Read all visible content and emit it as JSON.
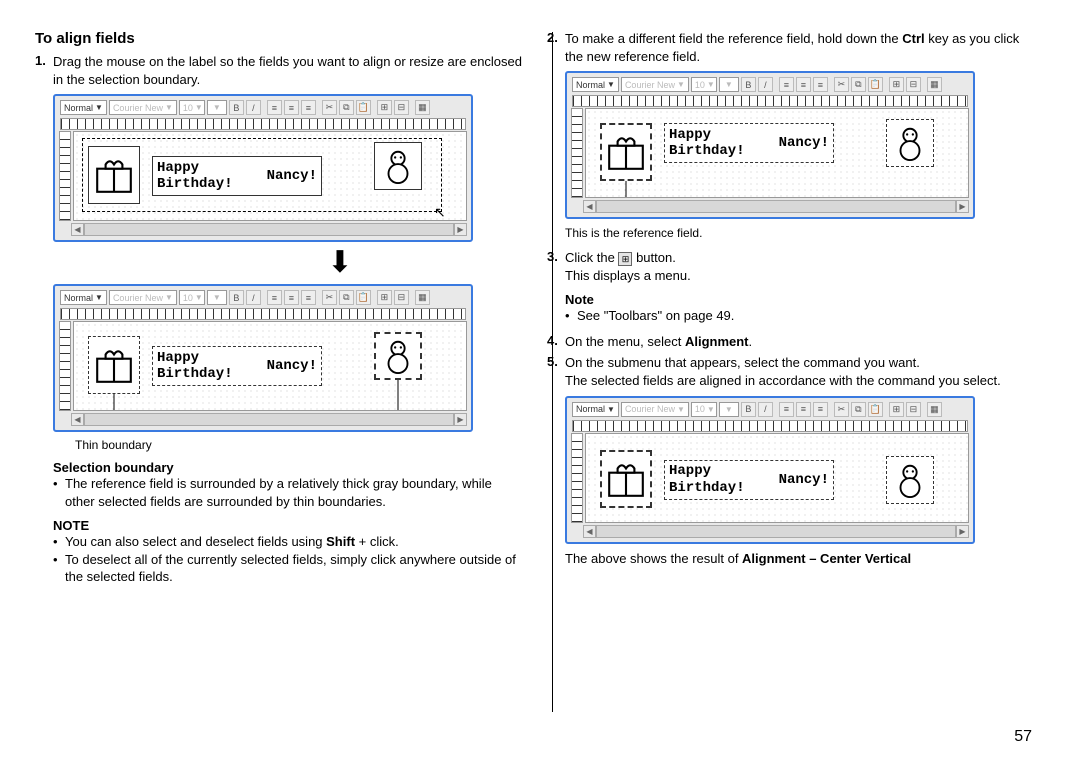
{
  "leftCol": {
    "heading": "To align fields",
    "step1_no": "1.",
    "step1": "Drag the mouse on the label so the fields you want to align or resize are enclosed in the selection boundary.",
    "thinBoundaryCaption": "Thin boundary",
    "selBoundaryHeading": "Selection boundary",
    "selBoundaryBullet": "The reference field is surrounded by a relatively thick gray boundary, while other selected fields are surrounded by thin boundaries.",
    "noteHeading": "NOTE",
    "note1_a": "You can also select and deselect fields using ",
    "note1_b": "Shift",
    "note1_c": " + click.",
    "note2": "To deselect all of the currently selected fields, simply click anywhere outside of the selected fields."
  },
  "rightCol": {
    "step2_no": "2.",
    "step2_a": "To make a different field the reference field, hold down the ",
    "step2_b": "Ctrl",
    "step2_c": " key as you click the new reference field.",
    "refCaption": "This is the reference field.",
    "step3_no": "3.",
    "step3_a": "Click the ",
    "step3_b": " button.",
    "step3_c": "This displays a menu.",
    "noteHeading": "Note",
    "note1": "See \"Toolbars\" on page 49.",
    "step4_no": "4.",
    "step4_a": "On the menu, select ",
    "step4_b": "Alignment",
    "step4_c": ".",
    "step5_no": "5.",
    "step5_a": "On the submenu that appears, select the command you want.",
    "step5_b": "The selected fields are aligned in accordance with the command you select.",
    "resultCaption_a": "The above shows the result of ",
    "resultCaption_b": "Alignment – Center Vertical"
  },
  "labelEditor": {
    "normal": "Normal",
    "font": "Courier New",
    "size": "10",
    "text1": "Happy Birthday!",
    "text2": "Nancy!"
  },
  "pageNumber": "57"
}
